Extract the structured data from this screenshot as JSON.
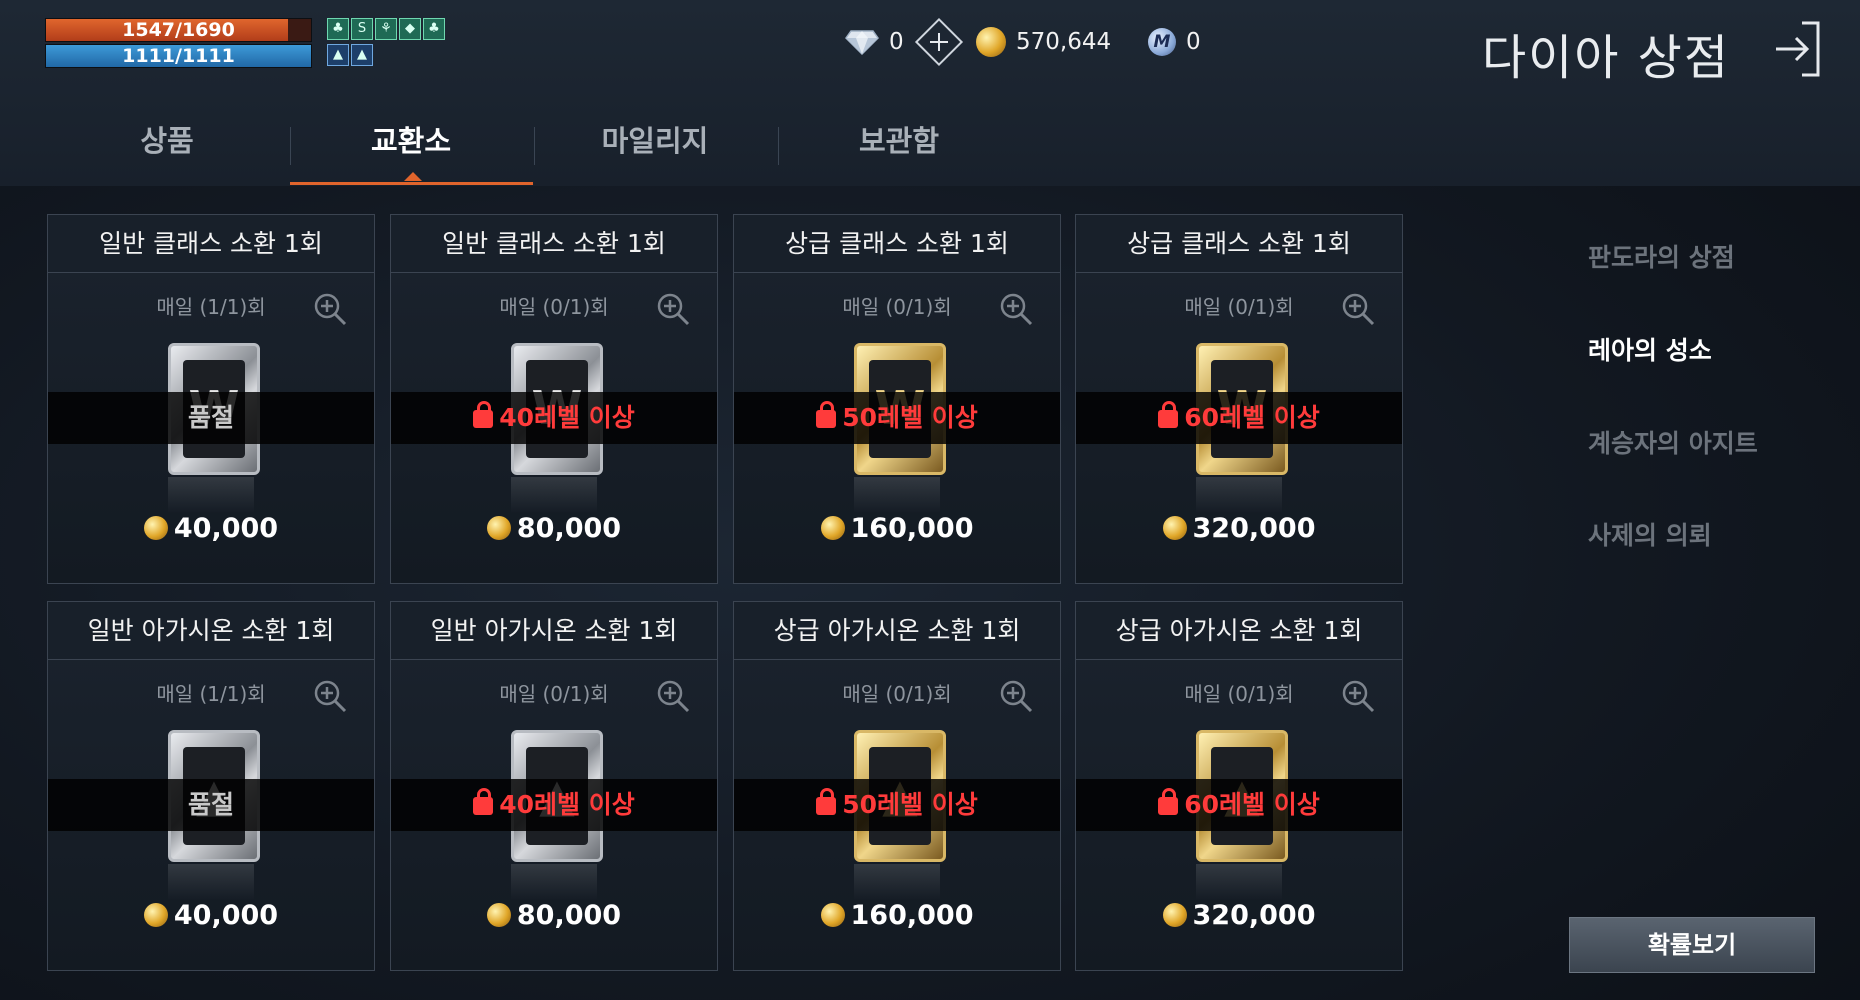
{
  "status": {
    "hp": "1547/1690",
    "mp": "1111/1111",
    "hp_fraction": 0.915,
    "mp_fraction": 1.0
  },
  "buffs": [
    "♣",
    "S",
    "⚘",
    "◆",
    "♣"
  ],
  "buffs2": [
    "▲",
    "▲"
  ],
  "currency": {
    "diamond": "0",
    "gold": "570,644",
    "mileage": "0",
    "mileage_symbol": "M"
  },
  "title": "다이아 상점",
  "tabs": [
    "상품",
    "교환소",
    "마일리지",
    "보관함"
  ],
  "side_menu": [
    "판도라의 상점",
    "레아의 성소",
    "계승자의 아지트",
    "사제의 의뢰"
  ],
  "cards": [
    {
      "title": "일반 클래스 소환 1회",
      "limit": "매일 (1/1)회",
      "status": "품절",
      "price": "40,000",
      "emblem": "W"
    },
    {
      "title": "일반 클래스 소환 1회",
      "limit": "매일 (0/1)회",
      "status": "40레벨 이상",
      "price": "80,000",
      "emblem": "W"
    },
    {
      "title": "상급 클래스 소환 1회",
      "limit": "매일 (0/1)회",
      "status": "50레벨 이상",
      "price": "160,000",
      "emblem": "W"
    },
    {
      "title": "상급 클래스 소환 1회",
      "limit": "매일 (0/1)회",
      "status": "60레벨 이상",
      "price": "320,000",
      "emblem": "W"
    },
    {
      "title": "일반 아가시온 소환 1회",
      "limit": "매일 (1/1)회",
      "status": "품절",
      "price": "40,000",
      "emblem": "▲"
    },
    {
      "title": "일반 아가시온 소환 1회",
      "limit": "매일 (0/1)회",
      "status": "40레벨 이상",
      "price": "80,000",
      "emblem": "▲"
    },
    {
      "title": "상급 아가시온 소환 1회",
      "limit": "매일 (0/1)회",
      "status": "50레벨 이상",
      "price": "160,000",
      "emblem": "▲"
    },
    {
      "title": "상급 아가시온 소환 1회",
      "limit": "매일 (0/1)회",
      "status": "60레벨 이상",
      "price": "320,000",
      "emblem": "▲"
    }
  ],
  "probability_button": "확률보기",
  "colors": {
    "accent": "#e0642c",
    "locked": "#ff3b3b",
    "silver_card": "#b8bcc2",
    "gold_card": "#d9b866"
  }
}
